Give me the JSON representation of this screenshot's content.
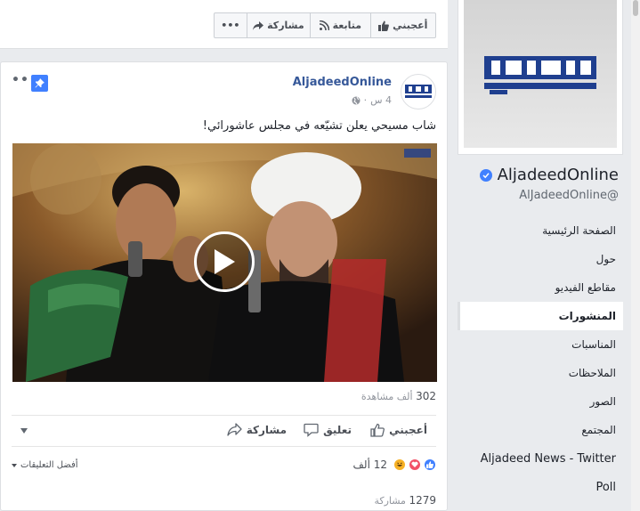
{
  "top_actions": {
    "more": "•••",
    "share": "مشاركة",
    "follow": "متابعة",
    "like": "أعجبني"
  },
  "post": {
    "author": "AljadeedOnline",
    "time": "4 س",
    "text": "شاب مسيحي يعلن تشيّعه في مجلس عاشورائي!",
    "views_num": "302",
    "views_text": "ألف مشاهدة",
    "actions": {
      "like": "أعجبني",
      "comment": "تعليق",
      "share": "مشاركة"
    },
    "best_comments": "أفضل التعليقات",
    "reactions_count": "12 ألف",
    "shares_num": "1279",
    "shares_text": "مشاركة"
  },
  "page": {
    "name": "AljadeedOnline",
    "handle": "AlJadeedOnline@"
  },
  "sidebar": {
    "items": [
      {
        "label": "الصفحة الرئيسية"
      },
      {
        "label": "حول"
      },
      {
        "label": "مقاطع الفيديو"
      },
      {
        "label": "المنشورات"
      },
      {
        "label": "المناسبات"
      },
      {
        "label": "الملاحظات"
      },
      {
        "label": "الصور"
      },
      {
        "label": "المجتمع"
      },
      {
        "label": "Aljadeed News - Twitter"
      },
      {
        "label": "Poll"
      }
    ]
  },
  "colors": {
    "brand_blue": "#4080ff",
    "link_blue": "#365899",
    "logo_blue": "#1f3f8f"
  }
}
